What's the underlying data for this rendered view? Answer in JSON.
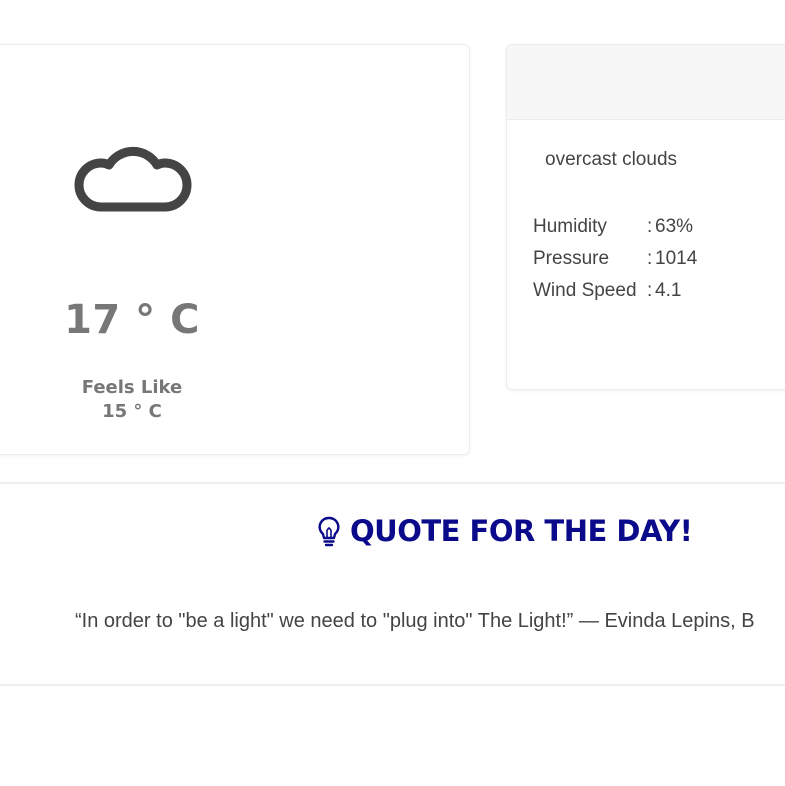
{
  "weather": {
    "icon": "cloud-icon",
    "temperature": "17 ° C",
    "feels_like_label": "Feels Like",
    "feels_like_value": "15 ° C"
  },
  "details": {
    "description": "overcast clouds",
    "stats": [
      {
        "label": "Humidity",
        "separator": ":",
        "value": "63%"
      },
      {
        "label": "Pressure",
        "separator": ":",
        "value": "1014"
      },
      {
        "label": "Wind Speed",
        "separator": ":",
        "value": "4.1"
      }
    ]
  },
  "quote": {
    "icon": "lightbulb-icon",
    "title": "QUOTE FOR THE DAY!",
    "text": "“In order to \"be a light\" we need to \"plug into\" The Light!” — Evinda Lepins, B"
  },
  "colors": {
    "icon_gray": "#444444",
    "temp_gray": "#777777",
    "quote_title_blue": "#0a0a8a",
    "text_gray": "#444444"
  }
}
